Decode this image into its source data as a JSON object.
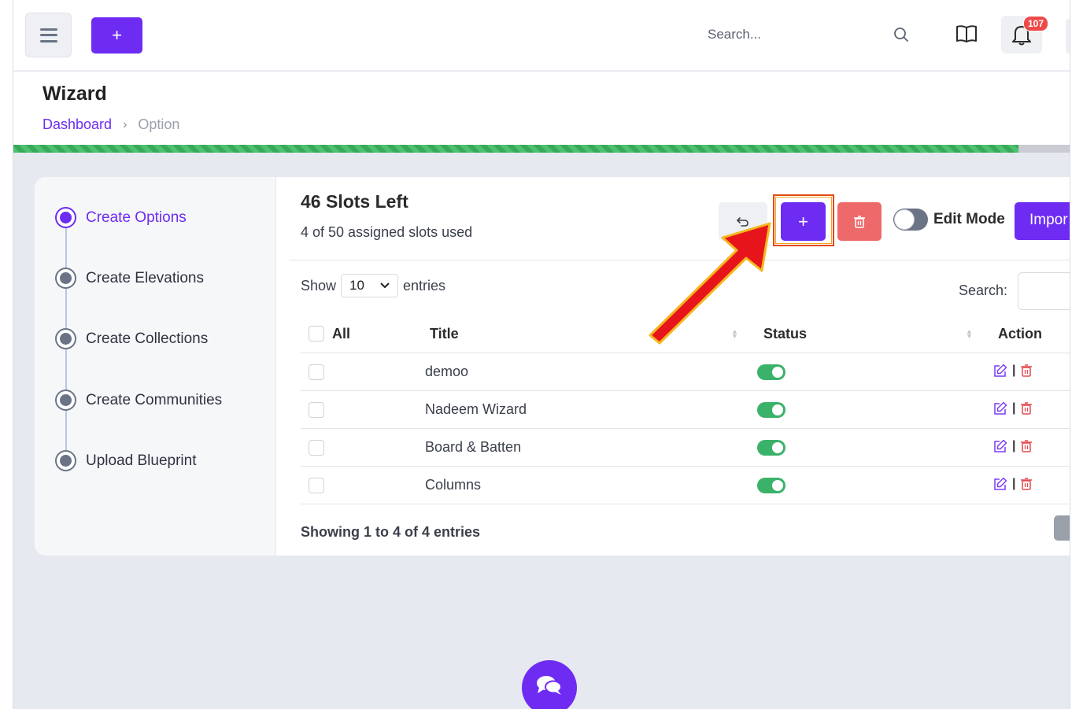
{
  "topbar": {
    "add_label": "+",
    "search_placeholder": "Search...",
    "notification_count": "107"
  },
  "header": {
    "title": "Wizard",
    "breadcrumb": [
      {
        "label": "Dashboard"
      },
      {
        "label": "Option"
      }
    ],
    "progress_fraction": 0.95
  },
  "steps": [
    {
      "label": "Create Options",
      "active": true
    },
    {
      "label": "Create Elevations",
      "active": false
    },
    {
      "label": "Create Collections",
      "active": false
    },
    {
      "label": "Create Communities",
      "active": false
    },
    {
      "label": "Upload Blueprint",
      "active": false
    }
  ],
  "slots": {
    "title": "46 Slots Left",
    "subtitle": "4 of 50 assigned slots used"
  },
  "toolbar": {
    "add_label": "+",
    "edit_mode_label": "Edit Mode",
    "edit_mode_on": false,
    "import_label": "Impor"
  },
  "table_controls": {
    "show_label": "Show",
    "page_size": "10",
    "entries_label": "entries",
    "search_label": "Search:"
  },
  "table": {
    "headers": {
      "all": "All",
      "title": "Title",
      "status": "Status",
      "action": "Action"
    },
    "rows": [
      {
        "title": "demoo",
        "status": true
      },
      {
        "title": "Nadeem Wizard",
        "status": true
      },
      {
        "title": "Board & Batten",
        "status": true
      },
      {
        "title": "Columns",
        "status": true
      }
    ],
    "action_separator": "|",
    "footer": "Showing 1 to 4 of 4 entries"
  },
  "colors": {
    "primary": "#6e2cf2",
    "danger": "#ee6a6a",
    "success": "#3bb26a",
    "highlight_box": "#e24a12",
    "arrow_fill": "#e8141c",
    "arrow_outline": "#f4b81f"
  },
  "icons": [
    "menu-icon",
    "plus-icon",
    "search-icon",
    "book-icon",
    "bell-icon",
    "undo-icon",
    "trash-icon",
    "edit-icon",
    "chat-icon"
  ]
}
